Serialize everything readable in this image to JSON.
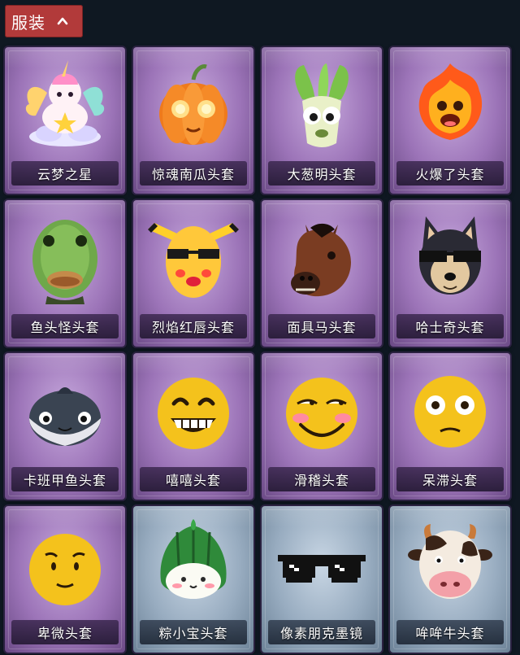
{
  "header": {
    "title": "服装",
    "chevron_icon": "chevron-up-icon"
  },
  "items": [
    {
      "label": "云梦之星",
      "tier": "purple",
      "icon": "unicorn-cloud-icon"
    },
    {
      "label": "惊魂南瓜头套",
      "tier": "purple",
      "icon": "pumpkin-head-icon"
    },
    {
      "label": "大葱明头套",
      "tier": "purple",
      "icon": "scallion-head-icon"
    },
    {
      "label": "火爆了头套",
      "tier": "purple",
      "icon": "fire-head-icon"
    },
    {
      "label": "鱼头怪头套",
      "tier": "purple",
      "icon": "fish-head-icon"
    },
    {
      "label": "烈焰红唇头套",
      "tier": "purple",
      "icon": "pikachu-lips-head-icon"
    },
    {
      "label": "面具马头套",
      "tier": "purple",
      "icon": "horse-mask-icon"
    },
    {
      "label": "哈士奇头套",
      "tier": "purple",
      "icon": "husky-head-icon"
    },
    {
      "label": "卡班甲鱼头套",
      "tier": "purple",
      "icon": "turtle-head-icon"
    },
    {
      "label": "嘻嘻头套",
      "tier": "purple",
      "icon": "grin-emoji-head-icon"
    },
    {
      "label": "滑稽头套",
      "tier": "purple",
      "icon": "funny-emoji-head-icon"
    },
    {
      "label": "呆滞头套",
      "tier": "purple",
      "icon": "stunned-emoji-head-icon"
    },
    {
      "label": "卑微头套",
      "tier": "purple",
      "icon": "humble-emoji-head-icon"
    },
    {
      "label": "粽小宝头套",
      "tier": "blue",
      "icon": "zongzi-head-icon"
    },
    {
      "label": "像素朋克墨镜",
      "tier": "blue",
      "icon": "pixel-sunglasses-icon"
    },
    {
      "label": "哞哞牛头套",
      "tier": "blue",
      "icon": "cow-head-icon"
    }
  ]
}
